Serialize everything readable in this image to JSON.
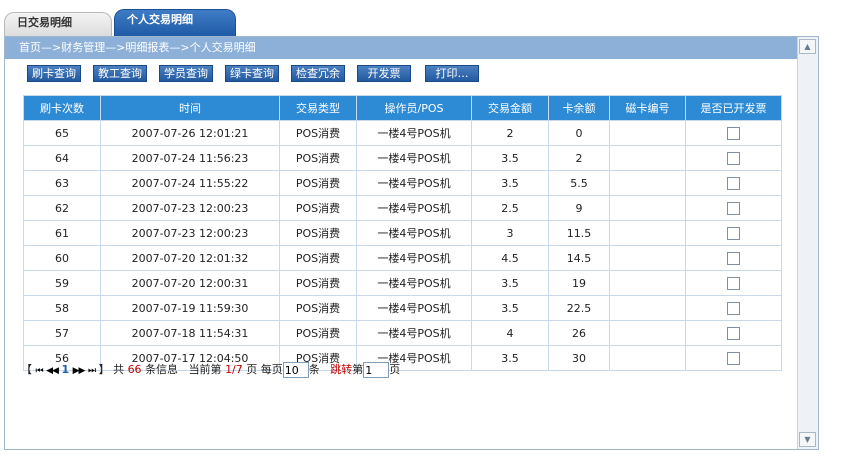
{
  "tabs": [
    {
      "label": "日交易明细",
      "active": false
    },
    {
      "label": "个人交易明细",
      "active": true
    }
  ],
  "breadcrumb": "首页—>财务管理—>明细报表—>个人交易明细",
  "toolbar": {
    "buttons": [
      "刷卡查询",
      "教工查询",
      "学员查询",
      "绿卡查询",
      "检查冗余",
      "开发票",
      "打印…"
    ]
  },
  "table": {
    "headers": [
      "刷卡次数",
      "时间",
      "交易类型",
      "操作员/POS",
      "交易金额",
      "卡余额",
      "磁卡编号",
      "是否已开发票"
    ],
    "rows": [
      [
        "65",
        "2007-07-26 12:01:21",
        "POS消费",
        "一楼4号POS机",
        "2",
        "0",
        ""
      ],
      [
        "64",
        "2007-07-24 11:56:23",
        "POS消费",
        "一楼4号POS机",
        "3.5",
        "2",
        ""
      ],
      [
        "63",
        "2007-07-24 11:55:22",
        "POS消费",
        "一楼4号POS机",
        "3.5",
        "5.5",
        ""
      ],
      [
        "62",
        "2007-07-23 12:00:23",
        "POS消费",
        "一楼4号POS机",
        "2.5",
        "9",
        ""
      ],
      [
        "61",
        "2007-07-23 12:00:23",
        "POS消费",
        "一楼4号POS机",
        "3",
        "11.5",
        ""
      ],
      [
        "60",
        "2007-07-20 12:01:32",
        "POS消费",
        "一楼4号POS机",
        "4.5",
        "14.5",
        ""
      ],
      [
        "59",
        "2007-07-20 12:00:31",
        "POS消费",
        "一楼4号POS机",
        "3.5",
        "19",
        ""
      ],
      [
        "58",
        "2007-07-19 11:59:30",
        "POS消费",
        "一楼4号POS机",
        "3.5",
        "22.5",
        ""
      ],
      [
        "57",
        "2007-07-18 11:54:31",
        "POS消费",
        "一楼4号POS机",
        "4",
        "26",
        ""
      ],
      [
        "56",
        "2007-07-17 12:04:50",
        "POS消费",
        "一楼4号POS机",
        "3.5",
        "30",
        ""
      ]
    ]
  },
  "pager": {
    "open_bracket": "【",
    "first": "⏮",
    "prev": "◀◀",
    "current_link": "1",
    "next": "▶▶",
    "last": "⏭",
    "close_bracket": "】",
    "total_prefix": "共",
    "total": "66",
    "total_suffix": "条信息",
    "current_prefix": "当前第",
    "current": "1/7",
    "current_suffix": "页",
    "per_page_prefix": "每页",
    "per_page": "10",
    "per_page_suffix": "条",
    "jump_label": "跳转",
    "jump_prefix": "第",
    "jump_value": "1",
    "jump_suffix": "页"
  },
  "colors": {
    "breadcrumb_bg": "#8db0d8",
    "header_bg": "#2d8bd6",
    "button_bg": "#225aa0",
    "tab_active_bg": "#1f5ba6"
  }
}
